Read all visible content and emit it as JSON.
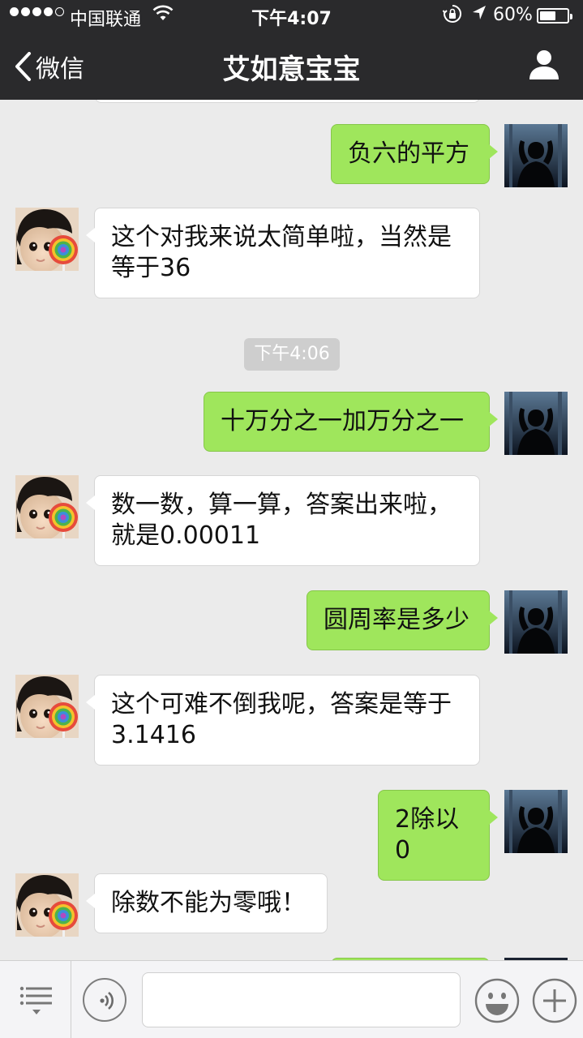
{
  "status_bar": {
    "carrier": "中国联通",
    "time": "下午4:07",
    "battery_percent_text": "60%",
    "battery_level": 0.6,
    "signal_dots_filled": 4,
    "signal_dots_total": 5,
    "icons": [
      "signal-dots",
      "wifi-icon",
      "rotation-lock-icon",
      "location-arrow-icon",
      "battery-icon"
    ]
  },
  "nav": {
    "back_label": "微信",
    "title": "艾如意宝宝",
    "icons": [
      "chevron-left-icon",
      "person-icon"
    ]
  },
  "chat": {
    "timestamp": "下午4:06",
    "messages": [
      {
        "from": "me",
        "text": "负六的平方"
      },
      {
        "from": "bot",
        "text": "这个对我来说太简单啦，当然是\n等于36"
      },
      {
        "from": "me",
        "text": "十万分之一加万分之一"
      },
      {
        "from": "bot",
        "text": "数一数，算一算，答案出来啦，\n就是0.00011"
      },
      {
        "from": "me",
        "text": "圆周率是多少"
      },
      {
        "from": "bot",
        "text": "这个可难不倒我呢，答案是等于\n3.1416"
      },
      {
        "from": "me",
        "text": "2除以0"
      },
      {
        "from": "bot",
        "text": "除数不能为零哦！"
      }
    ]
  },
  "toolbar": {
    "icons": [
      "menu-list-icon",
      "voice-icon",
      "emoji-icon",
      "plus-icon"
    ],
    "input_value": ""
  },
  "colors": {
    "nav_bg": "#2a2a2c",
    "chat_bg": "#ebebeb",
    "my_bubble": "#9fe65c",
    "bot_bubble": "#ffffff",
    "timestamp_bg": "#cecece"
  }
}
